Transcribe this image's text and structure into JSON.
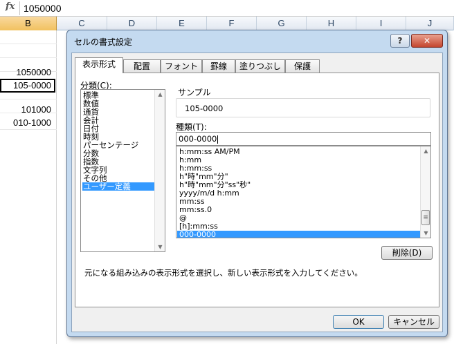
{
  "formula_bar": {
    "fx": "fx",
    "value": "1050000"
  },
  "columns": [
    "B",
    "C",
    "D",
    "E",
    "F",
    "G",
    "H",
    "I",
    "J"
  ],
  "cells": [
    {
      "value": "1050000"
    },
    {
      "value": "105-0000"
    },
    {
      "value": "101000"
    },
    {
      "value": "010-1000"
    }
  ],
  "dialog": {
    "title": "セルの書式設定",
    "help_label": "?",
    "close_label": "✕",
    "tabs": [
      "表示形式",
      "配置",
      "フォント",
      "罫線",
      "塗りつぶし",
      "保護"
    ],
    "active_tab": "表示形式",
    "category_label": "分類(C):",
    "categories": [
      "標準",
      "数値",
      "通貨",
      "会計",
      "日付",
      "時刻",
      "パーセンテージ",
      "分数",
      "指数",
      "文字列",
      "その他",
      "ユーザー定義"
    ],
    "selected_category": "ユーザー定義",
    "sample_label": "サンプル",
    "sample_value": "105-0000",
    "type_label": "種類(T):",
    "type_value": "000-0000",
    "format_list": [
      "h:mm:ss AM/PM",
      "h:mm",
      "h:mm:ss",
      "h\"時\"mm\"分\"",
      "h\"時\"mm\"分\"ss\"秒\"",
      "yyyy/m/d h:mm",
      "mm:ss",
      "mm:ss.0",
      "@",
      "[h]:mm:ss",
      "000-0000"
    ],
    "selected_format": "000-0000",
    "delete_label": "削除(D)",
    "description": "元になる組み込みの表示形式を選択し、新しい表示形式を入力してください。",
    "ok_label": "OK",
    "cancel_label": "キャンセル"
  },
  "colors": {
    "selection": "#3399ff",
    "dialog_frame": "#c4daf0",
    "column_header_selected": "#f1c15f"
  }
}
